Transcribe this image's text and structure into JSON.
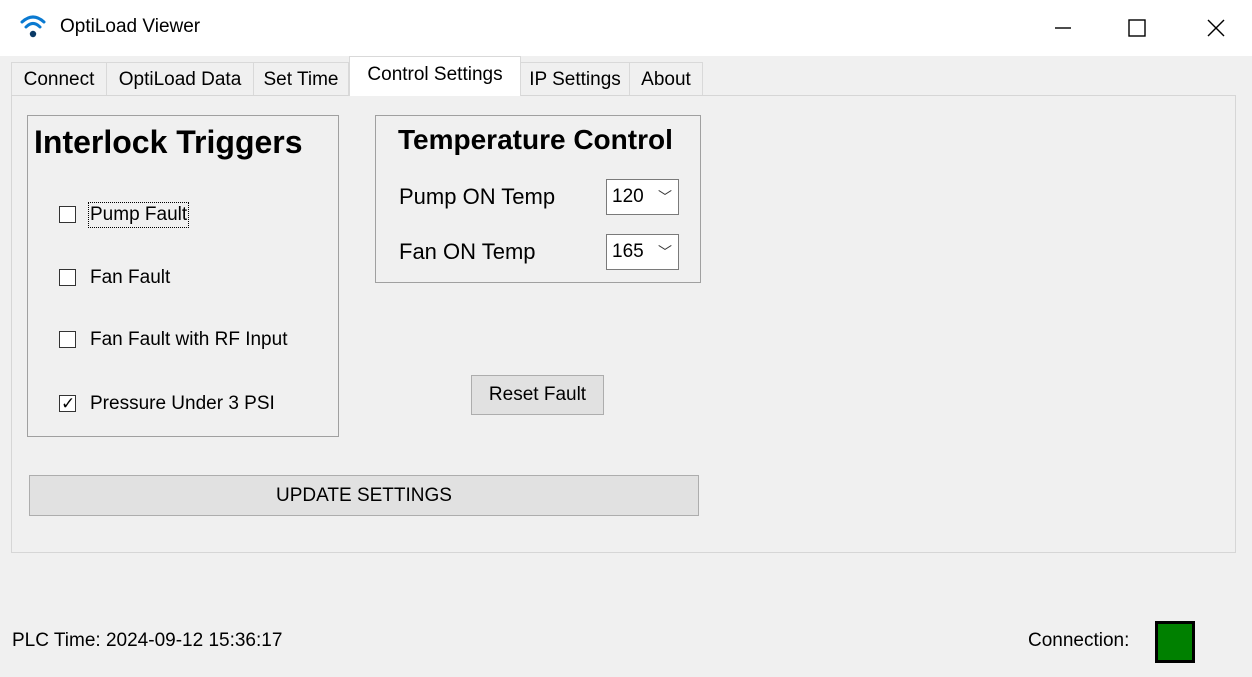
{
  "window": {
    "title": "OptiLoad Viewer",
    "icon": "wifi-icon",
    "controls": {
      "minimize": "minimize-icon",
      "maximize": "maximize-icon",
      "close": "close-icon"
    }
  },
  "tabs": [
    {
      "label": "Connect"
    },
    {
      "label": "OptiLoad Data"
    },
    {
      "label": "Set Time"
    },
    {
      "label": "Control Settings",
      "active": true
    },
    {
      "label": "IP Settings"
    },
    {
      "label": "About"
    }
  ],
  "interlock": {
    "title": "Interlock Triggers",
    "items": [
      {
        "label": "Pump Fault",
        "checked": false
      },
      {
        "label": "Fan Fault",
        "checked": false
      },
      {
        "label": "Fan Fault with RF Input",
        "checked": false
      },
      {
        "label": "Pressure Under 3 PSI",
        "checked": true
      }
    ]
  },
  "temperature": {
    "title": "Temperature Control",
    "pump_label": "Pump ON Temp",
    "pump_value": "120",
    "fan_label": "Fan ON Temp",
    "fan_value": "165"
  },
  "buttons": {
    "reset": "Reset Fault",
    "update": "UPDATE SETTINGS"
  },
  "status": {
    "plc_time": "PLC Time: 2024-09-12 15:36:17",
    "connection_label": "Connection:",
    "connection_color": "#008000"
  },
  "colors": {
    "background": "#f0f0f0",
    "button": "#e1e1e1"
  }
}
